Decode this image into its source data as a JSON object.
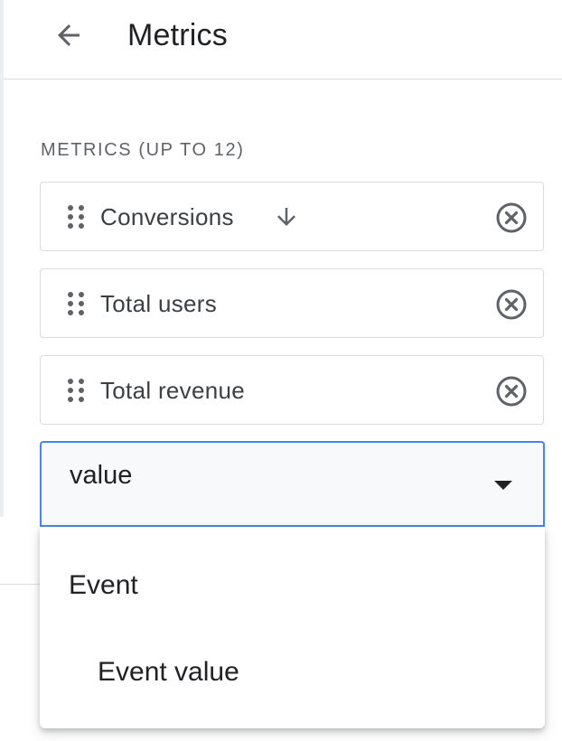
{
  "header": {
    "back_label": "Back",
    "title": "Metrics"
  },
  "section": {
    "label": "METRICS (UP TO 12)"
  },
  "metrics": [
    {
      "label": "Conversions",
      "sorted": "descending",
      "icon": "arrow-down-icon"
    },
    {
      "label": "Total users"
    },
    {
      "label": "Total revenue"
    }
  ],
  "search": {
    "value": "value",
    "focused": true,
    "accent_color": "#4285f4"
  },
  "dropdown": {
    "group_label": "Event",
    "options": [
      {
        "label": "Event value"
      }
    ]
  },
  "colors": {
    "text_primary": "#202124",
    "text_secondary": "#5f6368",
    "border": "#dadce0",
    "focus": "#4285f4",
    "icon": "#5f6368"
  }
}
